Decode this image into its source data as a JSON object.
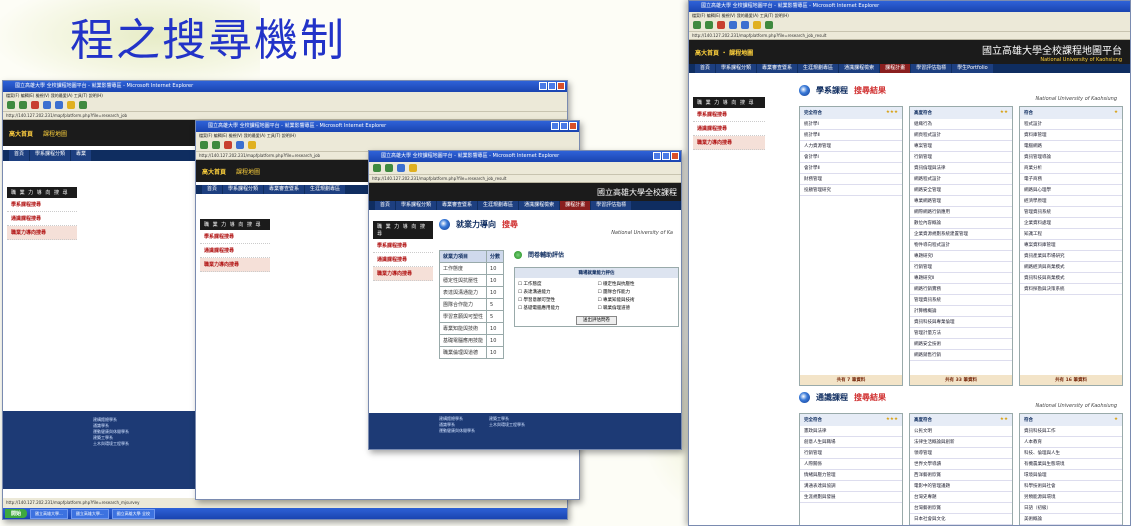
{
  "slide": {
    "title": "程之搜尋機制"
  },
  "colors": {
    "title": "#2233c8",
    "titlebar": "#1a44b0",
    "site_header": "#1b1b1b",
    "nav": "#0f2d60",
    "accent_red": "#b01010"
  },
  "window1": {
    "title": "國立高雄大學 全校課程地圖平台 - 就業影響專區 - Microsoft Internet Explorer",
    "menu": "檔案(F)  編輯(E)  檢視(V)  我的最愛(A)  工具(T)  說明(H)",
    "address": "http://140.127.202.231/mapfplatform.php?file=research_job",
    "nav": [
      "首頁",
      "學系課程分類",
      "專業"
    ],
    "side_title": "職 業 力 導 向 搜 尋",
    "side_items": [
      "學系課程搜尋",
      "通識課程搜尋",
      "職業力導向搜尋"
    ],
    "footer_lines": [
      "建構館總學系",
      "通識學系",
      "運動健康與休閒學系",
      "建築工學系",
      "土木與環境工程學系"
    ],
    "status": "http://140.127.202.231/mapfplatform.php?file=research_mjsurvey",
    "taskbar": {
      "start": "開始",
      "tasks": [
        "國立高雄大學...",
        "國立高雄大學...",
        "國立高雄大學 全校"
      ]
    }
  },
  "window2": {
    "title": "國立高雄大學 全校課程地圖平台 - 就業影響專區 - Microsoft Internet Explorer",
    "nav": [
      "首頁",
      "學系課程分類",
      "專業審查暨系",
      "生涯規劃專區"
    ],
    "side_title": "職 業 力 導 向 搜 尋",
    "side_items": [
      "學系課程搜尋",
      "通識課程搜尋",
      "職業力導向搜尋"
    ]
  },
  "window3": {
    "title": "國立高雄大學 全校課程地圖平台 - 就業影響專區 - Microsoft Internet Explorer",
    "site_title": "國立高雄大學全校課程",
    "nav": [
      "首頁",
      "學系課程分類",
      "專業審查暨系",
      "生涯規劃專區",
      "通識課程檢索",
      "課程計畫",
      "學習評估指標"
    ],
    "side_title": "職 業 力 導 向 搜 尋",
    "side_items": [
      "學系課程搜尋",
      "通識課程搜尋",
      "職業力導向搜尋"
    ],
    "section": {
      "title_plain": "就業力導向",
      "title_hi": "搜尋",
      "sub": "National University of Ka"
    },
    "pair_table": {
      "header": [
        "就業力項目",
        "分數"
      ],
      "rows": [
        [
          "工作態度",
          "10"
        ],
        [
          "穩定性與抗壓性",
          "10"
        ],
        [
          "表達與溝通能力",
          "10"
        ],
        [
          "團隊合作能力",
          "5"
        ],
        [
          "學習意願與可塑性",
          "5"
        ],
        [
          "專業知能與技術",
          "10"
        ],
        [
          "基礎電腦應用技能",
          "10"
        ],
        [
          "職業倫理與道德",
          "10"
        ]
      ]
    },
    "self_eval": {
      "title": "問卷輔助評估",
      "subtitle": "職場就業能力評估",
      "items": [
        "工作態度",
        "穩定性與抗壓性",
        "表達溝通能力",
        "團隊合作能力",
        "學習意願可塑性",
        "專業知能與技術",
        "基礎電腦應用能力",
        "職業倫理道德"
      ],
      "button": "送出評估問卷"
    }
  },
  "window4": {
    "address": "http://140.127.202.231/mapfplatform.php?file=research_job_result",
    "site_title": "國立高雄大學全校課程地圖平台",
    "site_sub": "National University of Kaohsiung",
    "nav": [
      "首頁",
      "學系課程分類",
      "專業審查暨系",
      "生涯規劃專區",
      "通識課程檢索",
      "課程計畫",
      "學習評估指標",
      "學生Portfolio"
    ],
    "side_title": "職 業 力 導 向 搜 尋",
    "side_items": [
      "學系課程搜尋",
      "通識課程搜尋",
      "職業力導向搜尋"
    ],
    "dept": {
      "title_plain": "學系課程",
      "title_hi": "搜尋結果",
      "sub": "National University of Kaohsiung",
      "columns": [
        {
          "head": "完全符合",
          "stars": "★★★",
          "items": [
            "統計學Ⅰ",
            "統計學Ⅱ",
            "人力資源管理",
            "會計學Ⅰ",
            "會計學Ⅱ",
            "財務管理",
            "投顧管理研究"
          ],
          "footer": "共有 7 筆資料"
        },
        {
          "head": "高度符合",
          "stars": "★★",
          "items": [
            "組織行為",
            "網頁程式設計",
            "專案管理",
            "行銷管理",
            "資訊倫理與法律",
            "網路程式設計",
            "網路安全管理",
            "專業網路管理",
            "網際網路行銷應用",
            "數位內容概論",
            "企業資源規劃系統建置管理",
            "物件導向程式設計",
            "專題研究Ⅰ",
            "行銷管理",
            "專題研究Ⅱ",
            "網路行銷實務",
            "管理資訊系統",
            "計算機概論",
            "資訊科技與專業倫理",
            "管理計量方法",
            "網路安全技術",
            "網路銷售行銷"
          ],
          "footer": "共有 33 筆資料"
        },
        {
          "head": "符合",
          "stars": "★",
          "items": [
            "程式設計",
            "資料庫管理",
            "電腦網路",
            "資訊管理導論",
            "商業分析",
            "電子商務",
            "網路與心理學",
            "經濟學原理",
            "管理資訊系統",
            "企業資料處理",
            "知識工程",
            "專案資料庫管理",
            "資訊產業與市場研究",
            "網路經濟與商業模式",
            "資訊科技與商業模式",
            "資料探勘與決策系統"
          ],
          "footer": "共有 16 筆資料"
        }
      ]
    },
    "general": {
      "title_plain": "通識課程",
      "title_hi": "搜尋結果",
      "sub": "National University of Kaohsiung",
      "columns": [
        {
          "head": "完全符合",
          "stars": "★★★",
          "items": [
            "憲政與法律",
            "創意人生與職場",
            "行銷管理",
            "人際關係",
            "情緒與壓力管理",
            "溝通表達與協調",
            "生涯規劃與發展"
          ]
        },
        {
          "head": "高度符合",
          "stars": "★★",
          "items": [
            "公民文明",
            "法律生活概論與創新",
            "領導管理",
            "世界文學導讀",
            "西洋藝術欣賞",
            "電影中的管理議題",
            "台灣史專題",
            "台灣藝術欣賞",
            "日本社會與文化",
            "臺灣印象"
          ]
        },
        {
          "head": "符合",
          "stars": "★",
          "items": [
            "資訊科技與工作",
            "人本教育",
            "科技、倫理與人生",
            "有機農業與生態環境",
            "環境與倫理",
            "科學技術與社會",
            "另類能源與環境",
            "日語（初級）",
            "美術概論",
            "民法與生活"
          ]
        }
      ]
    }
  }
}
